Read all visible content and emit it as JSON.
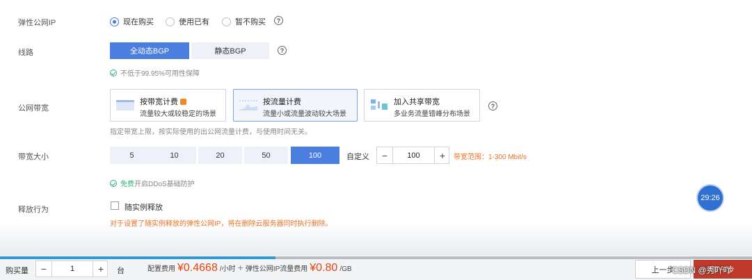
{
  "eip": {
    "label": "弹性公网IP",
    "options": [
      {
        "label": "现在购买",
        "checked": true
      },
      {
        "label": "使用已有",
        "checked": false
      },
      {
        "label": "暂不购买",
        "checked": false
      }
    ]
  },
  "line": {
    "label": "线路",
    "options": [
      {
        "label": "全动态BGP",
        "selected": true
      },
      {
        "label": "静态BGP",
        "selected": false
      }
    ],
    "note": "不低于99.95%可用性保障"
  },
  "bandwidth": {
    "label": "公网带宽",
    "cards": [
      {
        "title": "按带宽计费",
        "desc": "流量较大或较稳定的场景",
        "selected": false
      },
      {
        "title": "按流量计费",
        "desc": "流量小或流量波动较大场景",
        "selected": true
      },
      {
        "title": "加入共享带宽",
        "desc": "多业务流量错峰分布场景",
        "selected": false
      }
    ],
    "note": "指定带宽上限，按实际使用的出公网流量计费，与使用时间无关。"
  },
  "size": {
    "label": "带宽大小",
    "options": [
      "5",
      "10",
      "20",
      "50",
      "100"
    ],
    "selected": "100",
    "custom_label": "自定义",
    "stepper_value": "100",
    "range_text": "带宽范围：1-300 Mbit/s",
    "ddos_free": "免费",
    "ddos_text": "开启DDoS基础防护"
  },
  "release": {
    "label": "释放行为",
    "checkbox_label": "随实例释放",
    "warning": "对于设置了随实例释放的弹性公网IP，将在删除云服务器同时执行删除。"
  },
  "timer": "29:26",
  "video_progress": 0.366,
  "bottom": {
    "qty_label": "购买量",
    "qty_value": "1",
    "qty_unit": "台",
    "fee_label": "配置费用",
    "fee_value": "¥0.4668",
    "fee_unit": "/小时",
    "plus": "+",
    "eip_fee_label": "弹性公网IP流量费用",
    "eip_fee_value": "¥0.80",
    "eip_fee_unit": "/GB",
    "prev_button": "上一步",
    "next_button": "下一步",
    "watermark": "CSDN @秀吖吖"
  },
  "colors": {
    "accent": "#4a7fe0",
    "price": "#e8430d",
    "warning": "#e8742a",
    "success": "#2fb37a"
  }
}
